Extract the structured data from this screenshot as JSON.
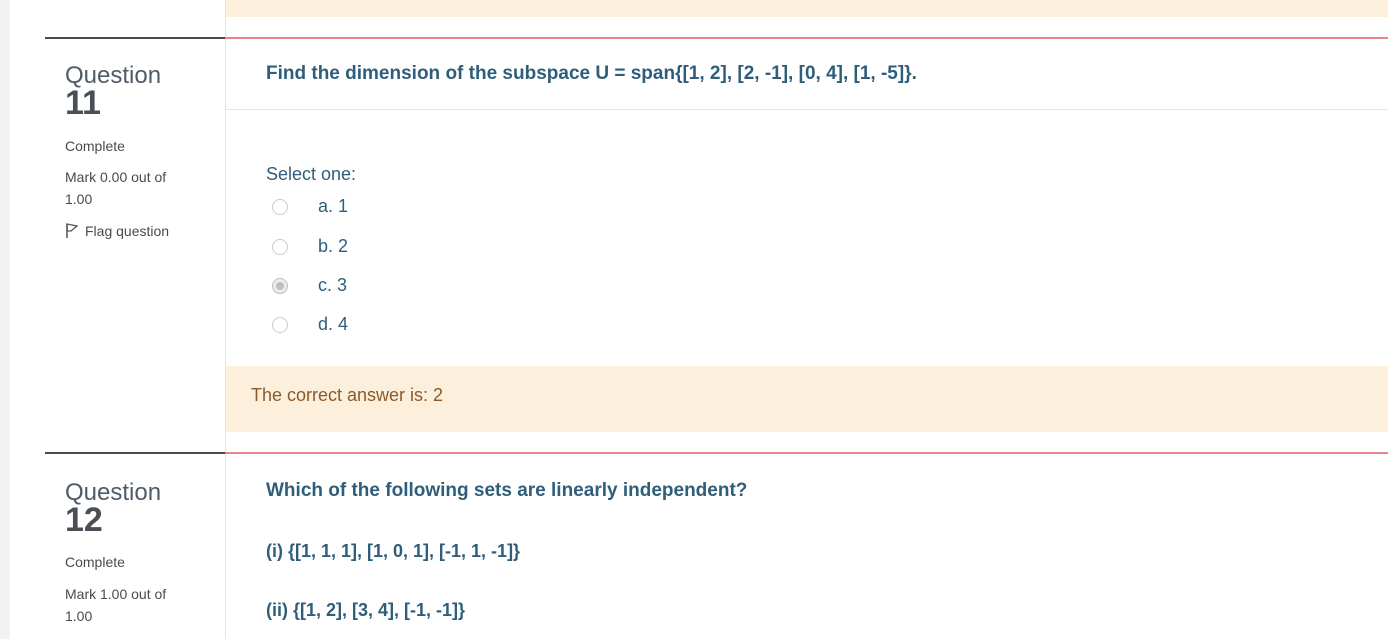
{
  "q11": {
    "label": "Question",
    "number": "11",
    "state": "Complete",
    "mark": "Mark 0.00 out of 1.00",
    "flag": "Flag question",
    "text": "Find the dimension of the subspace U = span{[1, 2], [2, -1], [0, 4], [1, -5]}.",
    "prompt": "Select one:",
    "options": [
      {
        "label": "a. 1",
        "checked": false
      },
      {
        "label": "b. 2",
        "checked": false
      },
      {
        "label": "c. 3",
        "checked": true
      },
      {
        "label": "d. 4",
        "checked": false
      }
    ],
    "feedback": "The correct answer is: 2"
  },
  "q12": {
    "label": "Question",
    "number": "12",
    "state": "Complete",
    "mark": "Mark 1.00 out of 1.00",
    "text": "Which of the following sets are linearly independent?",
    "set1": "(i) {[1, 1, 1], [1, 0, 1], [-1, 1, -1]}",
    "set2": "(ii) {[1, 2], [3, 4], [-1, -1]}"
  }
}
